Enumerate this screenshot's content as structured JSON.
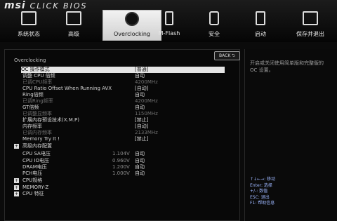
{
  "brand": {
    "msi": "msi",
    "bios": "CLICK BIOS"
  },
  "nav": [
    {
      "label": "系统状态"
    },
    {
      "label": "高级"
    },
    {
      "label": "Overclocking"
    },
    {
      "label": "M-Flash"
    },
    {
      "label": "安全"
    },
    {
      "label": "启动"
    },
    {
      "label": "保存并退出"
    }
  ],
  "panel": {
    "title": "Overclocking",
    "back_label": "BACK",
    "rows": [
      {
        "label": "OC 操作模式",
        "value": "[普通]",
        "selected": true
      },
      {
        "label": "调整 CPU 倍频",
        "value": "自动"
      },
      {
        "label": "已调CPU频率",
        "value": "4200MHz",
        "dim": true
      },
      {
        "label": "CPU Ratio Offset When Running AVX",
        "value": "[自动]"
      },
      {
        "label": "Ring倍频",
        "value": "自动"
      },
      {
        "label": "已调Ring频率",
        "value": "4200MHz",
        "dim": true
      },
      {
        "label": "GT倍频",
        "value": "自动"
      },
      {
        "label": "已调整显频率",
        "value": "1150MHz",
        "dim": true
      },
      {
        "label": "扩展内存预设技术(X.M.P)",
        "value": "[禁止]"
      },
      {
        "label": "内存频率",
        "value": "[自动]"
      },
      {
        "label": "已调内存频率",
        "value": "2133MHz",
        "dim": true
      },
      {
        "label": "Memory Try It !",
        "value": "[禁止]"
      }
    ],
    "submenu_memory": "高级内存配置",
    "voltages": [
      {
        "label": "CPU SA电压",
        "reading": "1.104V",
        "value": "自动"
      },
      {
        "label": "CPU IO电压",
        "reading": "0.960V",
        "value": "自动"
      },
      {
        "label": "DRAM电压",
        "reading": "1.200V",
        "value": "自动"
      },
      {
        "label": "PCH电压",
        "reading": "1.000V",
        "value": "自动"
      }
    ],
    "submenus": [
      "CPU规格",
      "MEMORY-Z",
      "CPU 特征"
    ]
  },
  "help": {
    "text": "开启或关闭使用简单版和完整版的 OC 设置。",
    "keys": [
      "↑↓←→: 移动",
      "Enter: 选择",
      "+/-: 数值",
      "ESC: 退出",
      "F1: 帮助信息"
    ]
  },
  "colors": {
    "accent": "#e4e4e4",
    "key_help": "#9db7ff"
  }
}
